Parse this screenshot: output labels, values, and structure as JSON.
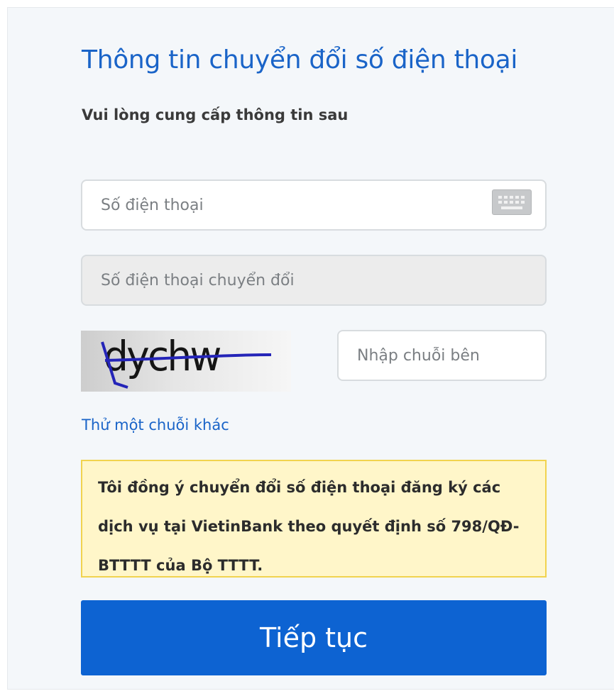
{
  "form": {
    "title": "Thông tin chuyển đổi số điện thoại",
    "subtitle": "Vui lòng cung cấp thông tin sau",
    "phone_input": {
      "placeholder": "Số điện thoại",
      "value": ""
    },
    "keyboard_icon": "keyboard-icon",
    "converted_phone_input": {
      "placeholder": "Số điện thoại chuyển đổi",
      "value": ""
    },
    "captcha": {
      "text": "dychw"
    },
    "captcha_input": {
      "placeholder": "Nhập chuỗi bên",
      "value": ""
    },
    "refresh_captcha_link": "Thử một chuỗi khác",
    "consent_text": "Tôi đồng ý chuyển đổi số điện thoại đăng ký các dịch vụ tại VietinBank theo quyết định số 798/QĐ-BTTTT của Bộ TTTT.",
    "continue_button": "Tiếp tục"
  },
  "colors": {
    "accent": "#1a64c8",
    "button": "#0d63d2",
    "notice_bg": "#fff6c9",
    "notice_border": "#f1d34f",
    "panel_bg": "#f4f7fa"
  }
}
